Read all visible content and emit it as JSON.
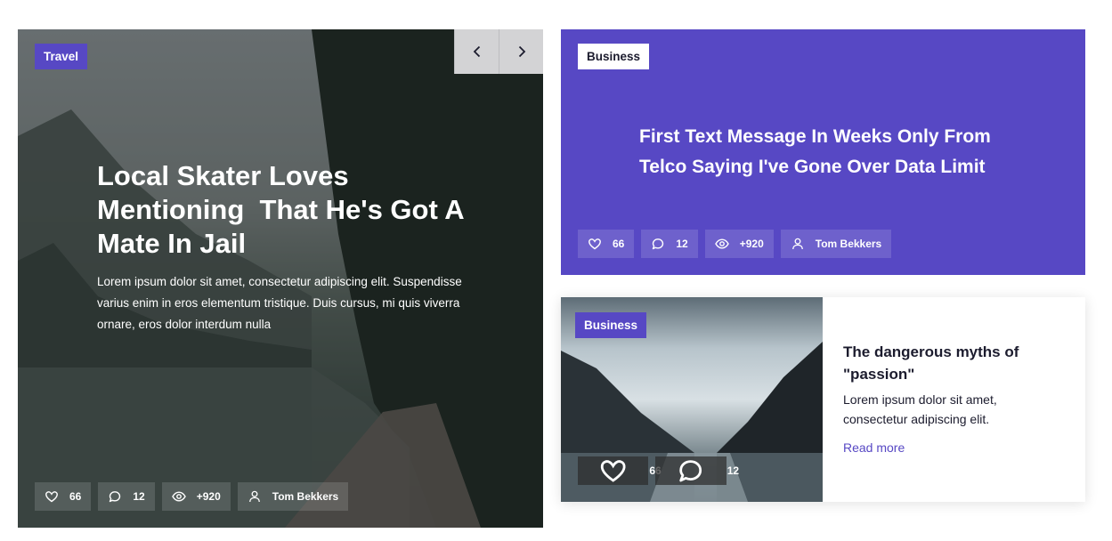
{
  "hero": {
    "category": "Travel",
    "title": "Local Skater Loves Mentioning  That He's Got A Mate In Jail",
    "description": "Lorem ipsum dolor sit amet, consectetur adipiscing elit. Suspendisse varius enim in eros elementum tristique. Duis cursus, mi quis viverra ornare, eros dolor interdum nulla",
    "stats": {
      "likes": "66",
      "comments": "12",
      "views": "+920",
      "author": "Tom Bekkers"
    },
    "nav": {
      "prev_icon": "chevron-left-icon",
      "next_icon": "chevron-right-icon"
    }
  },
  "feature": {
    "category": "Business",
    "title": "First Text Message In Weeks Only From Telco Saying I've Gone Over Data Limit",
    "stats": {
      "likes": "66",
      "comments": "12",
      "views": "+920",
      "author": "Tom Bekkers"
    }
  },
  "post": {
    "category": "Business",
    "title": "The dangerous myths of \"passion\"",
    "description": "Lorem ipsum dolor sit amet, consectetur adipiscing elit.",
    "read_more": "Read more",
    "stats": {
      "likes": "66",
      "comments": "12"
    }
  },
  "colors": {
    "accent": "#5748c4",
    "text_dark": "#1c1c2e",
    "white": "#ffffff"
  },
  "icons": {
    "likes": "heart-icon",
    "comments": "comment-icon",
    "views": "eye-icon",
    "author": "user-icon"
  }
}
